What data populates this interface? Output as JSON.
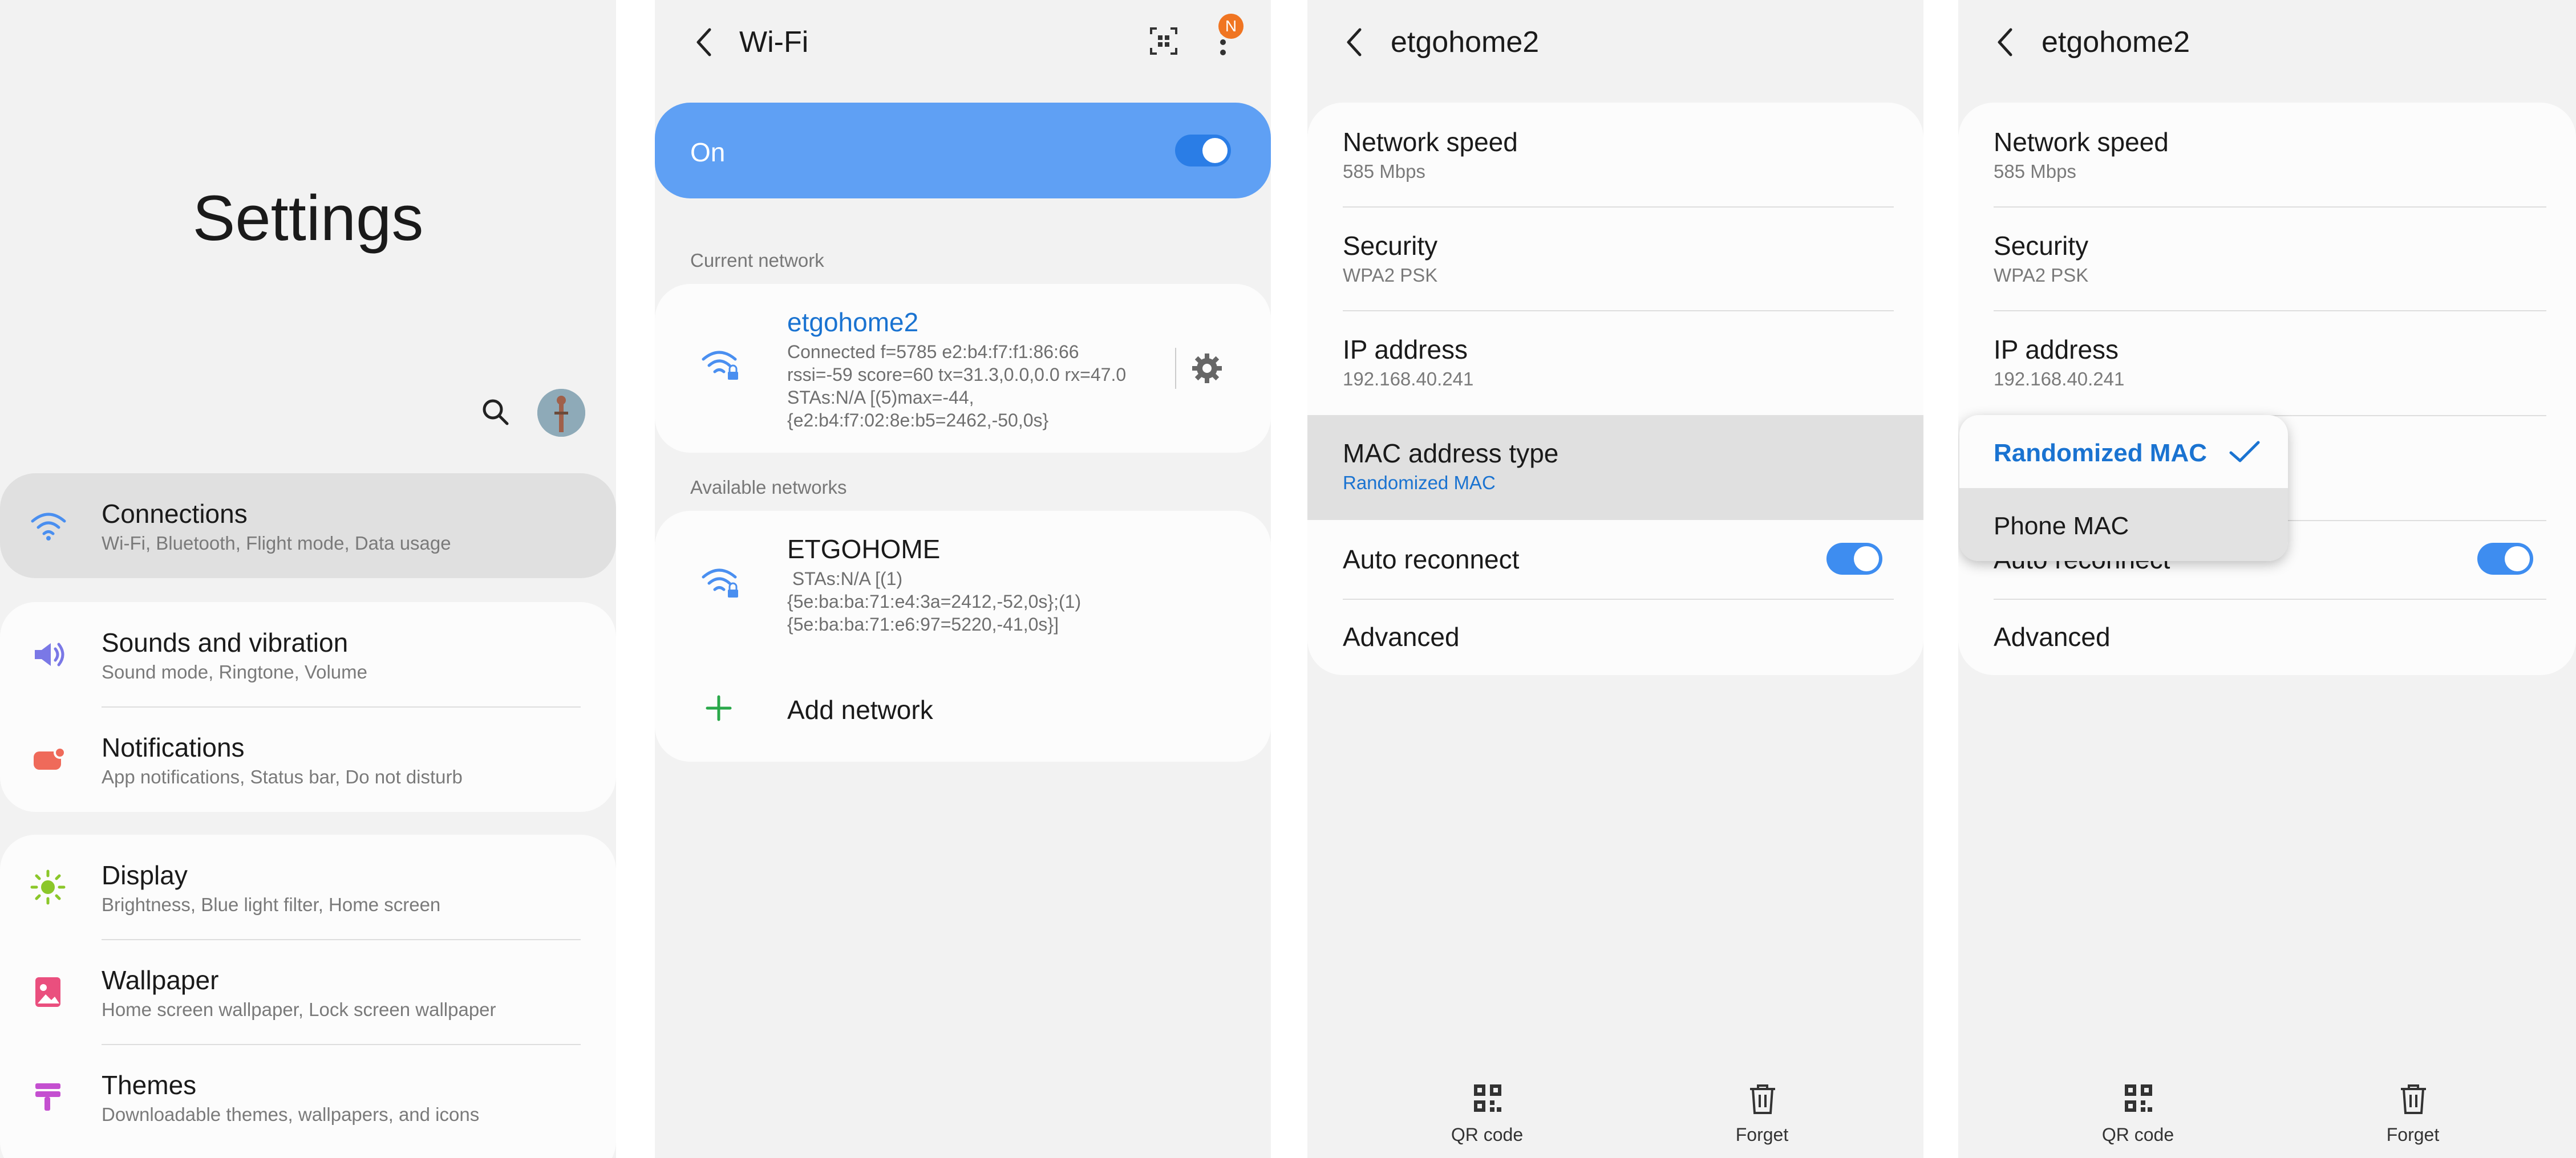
{
  "settings": {
    "title": "Settings",
    "items": [
      {
        "label": "Connections",
        "sub": "Wi-Fi, Bluetooth, Flight mode, Data usage",
        "icon": "wifi-icon"
      },
      {
        "label": "Sounds and vibration",
        "sub": "Sound mode, Ringtone, Volume",
        "icon": "speaker-icon"
      },
      {
        "label": "Notifications",
        "sub": "App notifications, Status bar, Do not disturb",
        "icon": "notification-icon"
      },
      {
        "label": "Display",
        "sub": "Brightness, Blue light filter, Home screen",
        "icon": "sun-icon"
      },
      {
        "label": "Wallpaper",
        "sub": "Home screen wallpaper, Lock screen wallpaper",
        "icon": "wallpaper-icon"
      },
      {
        "label": "Themes",
        "sub": "Downloadable themes, wallpapers, and icons",
        "icon": "themes-icon"
      }
    ]
  },
  "wifi": {
    "title": "Wi-Fi",
    "badge": "N",
    "master_label": "On",
    "current_header": "Current network",
    "current": {
      "name": "etgohome2",
      "lines": [
        "Connected f=5785  e2:b4:f7:f1:86:66",
        "rssi=-59  score=60 tx=31.3,0.0,0.0 rx=47.0",
        "STAs:N/A [(5)max=-44,",
        "{e2:b4:f7:02:8e:b5=2462,-50,0s}"
      ]
    },
    "available_header": "Available networks",
    "available": {
      "name": "ETGOHOME",
      "lines": [
        " STAs:N/A [(1)",
        "{5e:ba:ba:71:e4:3a=2412,-52,0s};(1)",
        "{5e:ba:ba:71:e6:97=5220,-41,0s}]"
      ]
    },
    "add_network": "Add network"
  },
  "network": {
    "title": "etgohome2",
    "speed_label": "Network speed",
    "speed_value": "585 Mbps",
    "security_label": "Security",
    "security_value": "WPA2 PSK",
    "ip_label": "IP address",
    "ip_value": "192.168.40.241",
    "mac_label": "MAC address type",
    "mac_value": "Randomized MAC",
    "auto_label": "Auto reconnect",
    "advanced_label": "Advanced",
    "qr_label": "QR code",
    "forget_label": "Forget"
  },
  "popup": {
    "selected": "Randomized MAC",
    "other": "Phone MAC",
    "auto_visible": "Auto reconnect"
  },
  "colors": {
    "accent": "#3e8df0",
    "link": "#1a73d1",
    "badge": "#f07522"
  }
}
